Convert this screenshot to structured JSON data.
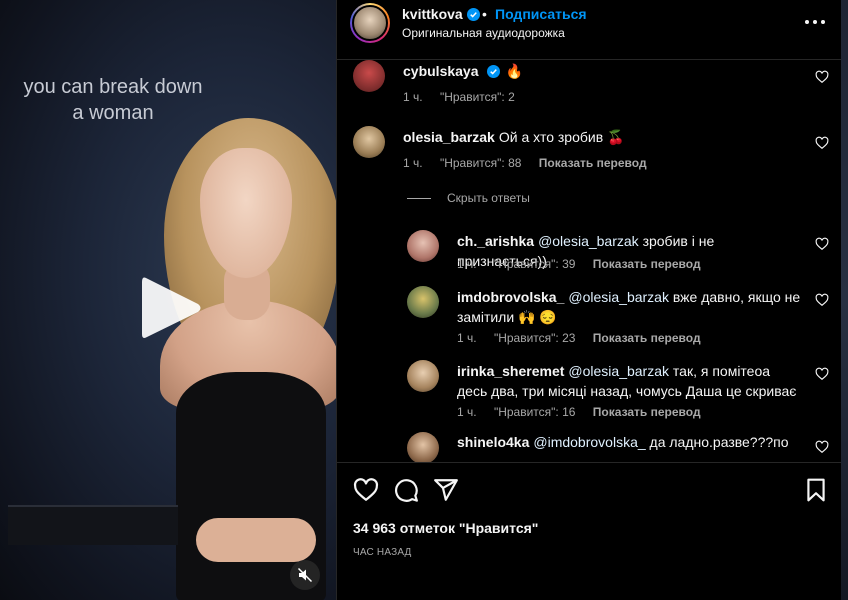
{
  "media": {
    "overlay_line1": "you can break down",
    "overlay_line2": "a woman",
    "play_icon": "play-icon",
    "mute_icon": "muted-speaker-icon"
  },
  "post_header": {
    "username": "kvittkova",
    "verified": true,
    "separator": "•",
    "follow_label": "Подписаться",
    "audio_label": "Оригинальная аудиодорожка",
    "more_icon": "more-options-icon"
  },
  "comments": [
    {
      "username": "cybulskaya",
      "verified": true,
      "text": "🔥",
      "time": "1 ч.",
      "likes": "\"Нравится\": 2",
      "translate": ""
    },
    {
      "username": "olesia_barzak",
      "verified": false,
      "text": "Ой а хто зробив 🍒",
      "time": "1 ч.",
      "likes": "\"Нравится\": 88",
      "translate": "Показать перевод"
    }
  ],
  "hide_replies_label": "Скрыть ответы",
  "replies": [
    {
      "username": "ch._arishka",
      "mention": "@olesia_barzak",
      "text": "зробив і не признається))",
      "time": "1 ч.",
      "likes": "\"Нравится\": 39",
      "translate": "Показать перевод"
    },
    {
      "username": "imdobrovolska_",
      "mention": "@olesia_barzak",
      "text": "вже давно, якщо не замітили 🙌 😔",
      "time": "1 ч.",
      "likes": "\"Нравится\": 23",
      "translate": "Показать перевод"
    },
    {
      "username": "irinka_sheremet",
      "mention": "@olesia_barzak",
      "text": "так, я помітеоа десь два, три місяці назад, чомусь Даша це скриває",
      "time": "1 ч.",
      "likes": "\"Нравится\": 16",
      "translate": "Показать перевод"
    },
    {
      "username": "shinelo4ka",
      "mention": "@imdobrovolska_",
      "text": "да ладно.разве???по",
      "time": "",
      "likes": "",
      "translate": ""
    }
  ],
  "actions": {
    "like_icon": "heart-icon",
    "comment_icon": "comment-icon",
    "share_icon": "share-icon",
    "save_icon": "bookmark-icon",
    "likes_count": "34 963 отметок \"Нравится\"",
    "timestamp": "ЧАС НАЗАД"
  },
  "colors": {
    "link_blue": "#0095f6",
    "verified_blue": "#0095f6",
    "text_primary": "#f5f5f5",
    "text_secondary": "#a8a8a8",
    "background": "#000000"
  }
}
